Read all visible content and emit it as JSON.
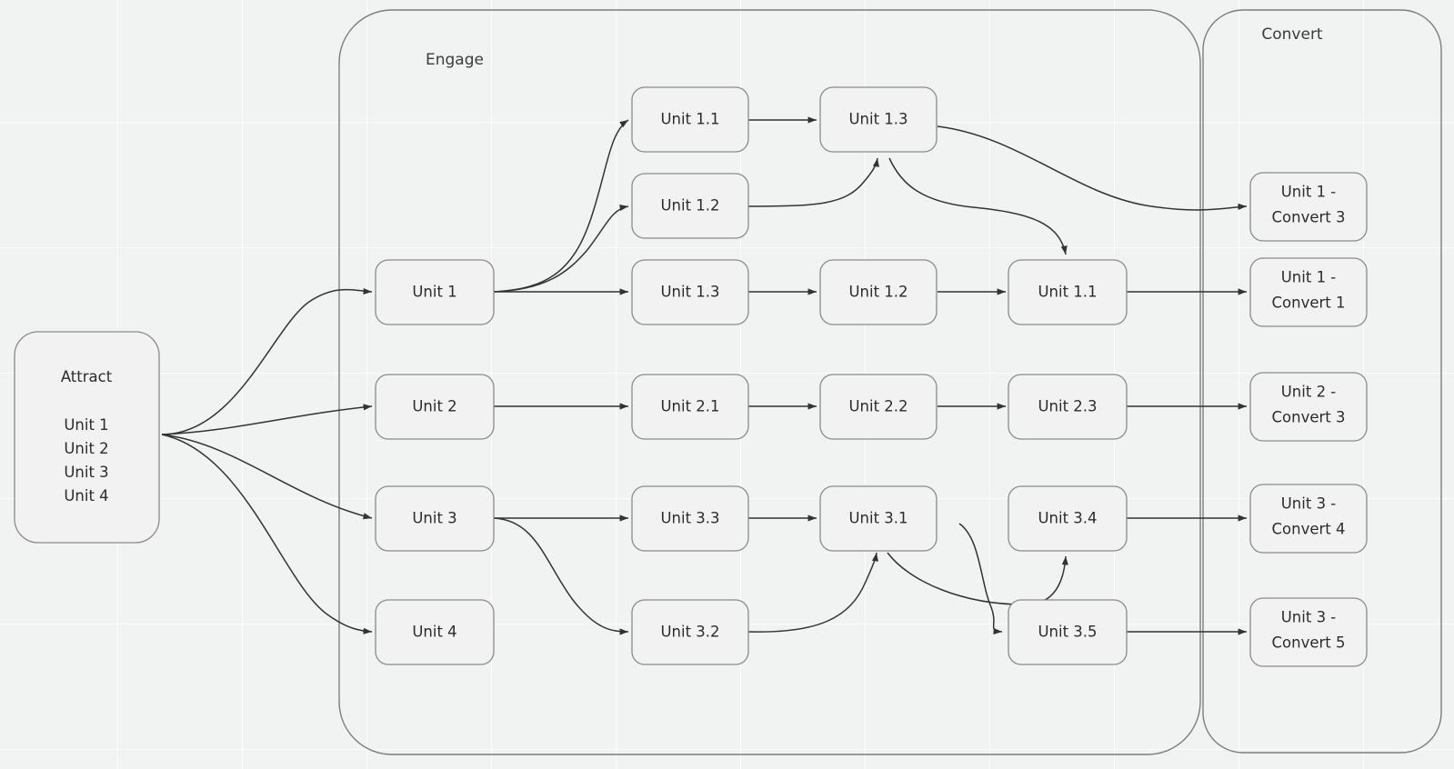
{
  "diagram": {
    "title_visible": false,
    "background_color": "#f1f2f2",
    "node_fill": "#f2f2f2",
    "node_stroke": "#8a8a8a",
    "edge_color": "#333333"
  },
  "groups": {
    "engage": {
      "label": "Engage"
    },
    "convert": {
      "label": "Convert"
    }
  },
  "attract": {
    "title": "Attract",
    "items": [
      {
        "label": "Unit 1"
      },
      {
        "label": "Unit 2"
      },
      {
        "label": "Unit 3"
      },
      {
        "label": "Unit 4"
      }
    ]
  },
  "nodes": {
    "col1": [
      {
        "id": "unit1",
        "label": "Unit 1"
      },
      {
        "id": "unit2",
        "label": "Unit 2"
      },
      {
        "id": "unit3",
        "label": "Unit 3"
      },
      {
        "id": "unit4",
        "label": "Unit 4"
      }
    ],
    "col2": [
      {
        "id": "u1_1_top",
        "label": "Unit 1.1"
      },
      {
        "id": "u1_2_top",
        "label": "Unit 1.2"
      },
      {
        "id": "u1_3_mid",
        "label": "Unit 1.3"
      },
      {
        "id": "u2_1",
        "label": "Unit 2.1"
      },
      {
        "id": "u3_3",
        "label": "Unit 3.3"
      },
      {
        "id": "u3_2",
        "label": "Unit 3.2"
      }
    ],
    "col3": [
      {
        "id": "u1_3_top",
        "label": "Unit 1.3"
      },
      {
        "id": "u1_2_mid",
        "label": "Unit 1.2"
      },
      {
        "id": "u2_2",
        "label": "Unit 2.2"
      },
      {
        "id": "u3_1",
        "label": "Unit 3.1"
      }
    ],
    "col4": [
      {
        "id": "u1_1_mid",
        "label": "Unit 1.1"
      },
      {
        "id": "u2_3",
        "label": "Unit 2.3"
      },
      {
        "id": "u3_4",
        "label": "Unit 3.4"
      },
      {
        "id": "u3_5",
        "label": "Unit 3.5"
      }
    ],
    "convert": [
      {
        "id": "c1_3",
        "line1": "Unit 1 -",
        "line2": "Convert 3"
      },
      {
        "id": "c1_1",
        "line1": "Unit 1 -",
        "line2": "Convert 1"
      },
      {
        "id": "c2_3",
        "line1": "Unit 2 -",
        "line2": "Convert 3"
      },
      {
        "id": "c3_4",
        "line1": "Unit 3 -",
        "line2": "Convert 4"
      },
      {
        "id": "c3_5",
        "line1": "Unit 3 -",
        "line2": "Convert 5"
      }
    ]
  },
  "edges": [
    {
      "from": "Attract",
      "to": "Unit 1"
    },
    {
      "from": "Attract",
      "to": "Unit 2"
    },
    {
      "from": "Attract",
      "to": "Unit 3"
    },
    {
      "from": "Attract",
      "to": "Unit 4"
    },
    {
      "from": "Unit 1",
      "to": "Unit 1.1"
    },
    {
      "from": "Unit 1",
      "to": "Unit 1.2"
    },
    {
      "from": "Unit 1",
      "to": "Unit 1.3"
    },
    {
      "from": "Unit 1.1",
      "to": "Unit 1.3"
    },
    {
      "from": "Unit 1.2",
      "to": "Unit 1.3"
    },
    {
      "from": "Unit 1.3",
      "to": "Unit 1 - Convert 3"
    },
    {
      "from": "Unit 1.3",
      "to": "Unit 1.1"
    },
    {
      "from": "Unit 1.3",
      "to": "Unit 1.2"
    },
    {
      "from": "Unit 1.2",
      "to": "Unit 1.1"
    },
    {
      "from": "Unit 1.1",
      "to": "Unit 1 - Convert 1"
    },
    {
      "from": "Unit 2",
      "to": "Unit 2.1"
    },
    {
      "from": "Unit 2.1",
      "to": "Unit 2.2"
    },
    {
      "from": "Unit 2.2",
      "to": "Unit 2.3"
    },
    {
      "from": "Unit 2.3",
      "to": "Unit 2 - Convert 3"
    },
    {
      "from": "Unit 3",
      "to": "Unit 3.3"
    },
    {
      "from": "Unit 3",
      "to": "Unit 3.2"
    },
    {
      "from": "Unit 3.3",
      "to": "Unit 3.1"
    },
    {
      "from": "Unit 3.2",
      "to": "Unit 3.1"
    },
    {
      "from": "Unit 3.1",
      "to": "Unit 3.5"
    },
    {
      "from": "Unit 3.5",
      "to": "Unit 3.4"
    },
    {
      "from": "Unit 3.4",
      "to": "Unit 3 - Convert 4"
    },
    {
      "from": "Unit 3.5",
      "to": "Unit 3 - Convert 5"
    }
  ]
}
